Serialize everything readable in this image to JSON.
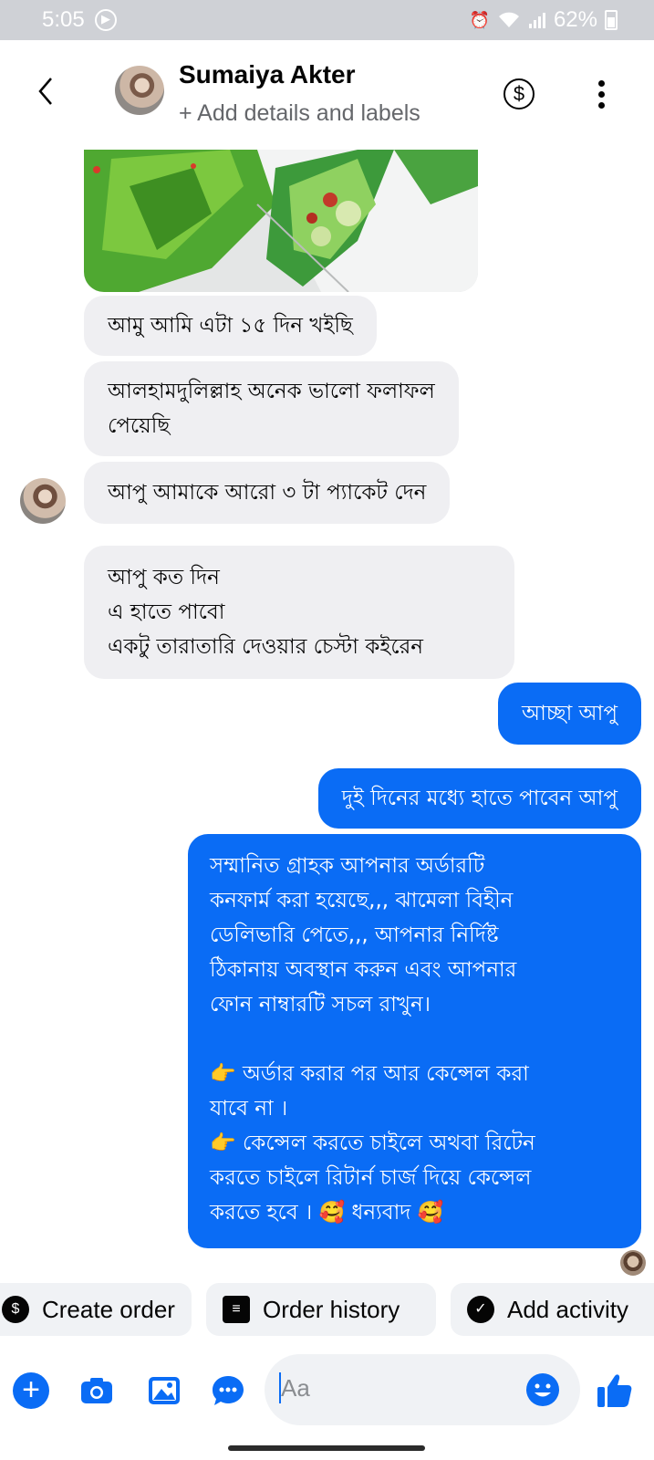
{
  "status_bar": {
    "time": "5:05",
    "battery": "62%"
  },
  "header": {
    "name": "Sumaiya Akter",
    "subtitle": "+ Add details and labels",
    "dollar_symbol": "$"
  },
  "messages": [
    {
      "from": "contact",
      "lines": [
        "আমু আমি এটা ১৫ দিন খইছি"
      ]
    },
    {
      "from": "contact",
      "lines": [
        "আলহামদুলিল্লাহ অনেক ভালো ফলাফল",
        "পেয়েছি"
      ]
    },
    {
      "from": "contact",
      "lines": [
        "আপু আমাকে আরো ৩ টা প্যাকেট দেন"
      ]
    },
    {
      "from": "contact",
      "lines": [
        "আপু কত দিন",
        "এ হাতে পাবো",
        "একটু তারাতারি দেওয়ার চেস্টা কইরেন"
      ]
    },
    {
      "from": "me",
      "lines": [
        "আচ্ছা আপু"
      ]
    },
    {
      "from": "me",
      "lines": [
        "দুই দিনের মধ্যে হাতে পাবেন আপু"
      ]
    },
    {
      "from": "me",
      "lines": [
        "সম্মানিত গ্রাহক আপনার অর্ডারটি",
        "কনফার্ম করা হয়েছে,,, ঝামেলা বিহীন",
        "ডেলিভারি পেতে,,, আপনার নির্দিষ্ট",
        "ঠিকানায় অবস্থান করুন এবং  আপনার",
        "ফোন নাম্বারটি সচল রাখুন।",
        "",
        "👉 অর্ডার করার পর আর কেন্সেল করা",
        "যাবে না ।",
        "👉 কেন্সেল করতে চাইলে অথবা রিটেন",
        "করতে চাইলে   রিটার্ন চার্জ দিয়ে কেন্সেল",
        "করতে  হবে । 🥰 ধন্যবাদ 🥰"
      ]
    }
  ],
  "quick_actions": {
    "create_order": "Create order",
    "order_history": "Order history",
    "add_activity": "Add activity"
  },
  "composer": {
    "placeholder": "Aa"
  },
  "colors": {
    "accent": "#0a6cf5",
    "incoming_bubble": "#efeff2",
    "status_bar": "#cfd1d6"
  },
  "icons": {
    "back": "chevron-left-icon",
    "money": "dollar-circle-icon",
    "menu": "more-vertical-icon",
    "plus": "plus-circle-icon",
    "camera": "camera-icon",
    "gallery": "image-icon",
    "chat": "chat-bubble-icon",
    "emoji": "emoji-icon",
    "like": "thumbs-up-icon"
  }
}
